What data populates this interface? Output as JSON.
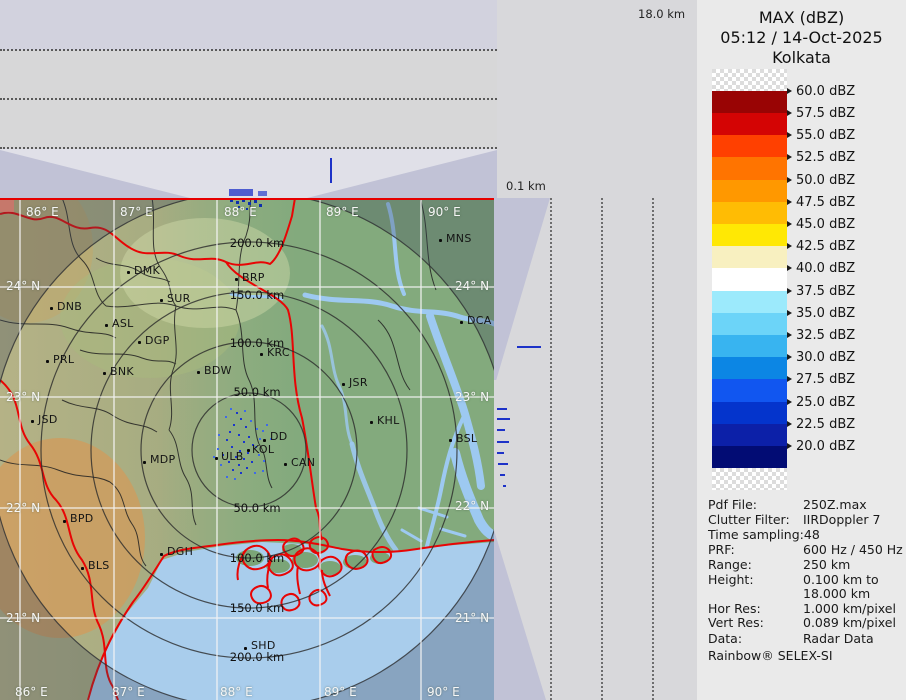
{
  "panels": {
    "top_height_label": "18.0 km",
    "side_height_label": "0.1 km"
  },
  "title": {
    "product": "MAX (dBZ)",
    "datetime": "05:12 / 14-Oct-2025",
    "site": "Kolkata"
  },
  "legend": {
    "labels": [
      "60.0 dBZ",
      "57.5 dBZ",
      "55.0 dBZ",
      "52.5 dBZ",
      "50.0 dBZ",
      "47.5 dBZ",
      "45.0 dBZ",
      "42.5 dBZ",
      "40.0 dBZ",
      "37.5 dBZ",
      "35.0 dBZ",
      "32.5 dBZ",
      "30.0 dBZ",
      "27.5 dBZ",
      "25.0 dBZ",
      "22.5 dBZ",
      "20.0 dBZ"
    ],
    "bands": [
      {
        "color": "#ffffff",
        "dither": true
      },
      {
        "color": "#990404"
      },
      {
        "color": "#d40404"
      },
      {
        "color": "#ff4000"
      },
      {
        "color": "#ff7400"
      },
      {
        "color": "#ff9800"
      },
      {
        "color": "#ffbc04"
      },
      {
        "color": "#ffe804"
      },
      {
        "color": "#f8f0c0"
      },
      {
        "color": "#ffffff"
      },
      {
        "color": "#9ceafc"
      },
      {
        "color": "#6cd4f8"
      },
      {
        "color": "#38b4f0"
      },
      {
        "color": "#0c86e4"
      },
      {
        "color": "#1156f0"
      },
      {
        "color": "#0434cc"
      },
      {
        "color": "#0c20a8"
      },
      {
        "color": "#020c74"
      },
      {
        "color": "#ffffff",
        "dither": true
      }
    ]
  },
  "metadata": {
    "rows": [
      {
        "label": "Pdf File:",
        "value": "250Z.max"
      },
      {
        "label": "Clutter Filter:",
        "value": "IIRDoppler 7"
      },
      {
        "label": "Time sampling:",
        "value": "48"
      },
      {
        "label": "PRF:",
        "value": "600 Hz / 450 Hz"
      },
      {
        "label": "Range:",
        "value": "250 km"
      },
      {
        "label": "Height:",
        "value": "0.100 km to"
      },
      {
        "label": "",
        "value": "18.000 km"
      },
      {
        "label": "Hor Res:",
        "value": "1.000 km/pixel"
      },
      {
        "label": "Vert Res:",
        "value": "0.089 km/pixel"
      },
      {
        "label": "Data:",
        "value": "Radar Data"
      }
    ],
    "footer": "Rainbow® SELEX-SI"
  },
  "map": {
    "lon_labels_top": [
      "86° E",
      "87° E",
      "88° E",
      "89° E",
      "90° E"
    ],
    "lon_labels_bottom": [
      "86° E",
      "87° E",
      "88° E",
      "89° E",
      "90° E"
    ],
    "lat_labels_left": [
      "24° N",
      "23° N",
      "22° N",
      "21° N"
    ],
    "lat_labels_right": [
      "24° N",
      "23° N",
      "22° N",
      "21° N"
    ],
    "ring_labels_top": [
      "200.0 km",
      "150.0 km",
      "100.0 km",
      "50.0 km"
    ],
    "ring_labels_bottom": [
      "50.0 km",
      "100.0 km",
      "150.0 km",
      "200.0 km"
    ],
    "stations": [
      {
        "code": "MNS"
      },
      {
        "code": "DMK"
      },
      {
        "code": "BRP"
      },
      {
        "code": "SUR"
      },
      {
        "code": "DNB"
      },
      {
        "code": "ASL"
      },
      {
        "code": "DGP"
      },
      {
        "code": "KRC"
      },
      {
        "code": "BDW"
      },
      {
        "code": "PRL"
      },
      {
        "code": "BNK"
      },
      {
        "code": "JSR"
      },
      {
        "code": "DCA"
      },
      {
        "code": "KHL"
      },
      {
        "code": "JSD"
      },
      {
        "code": "BSL"
      },
      {
        "code": "DD"
      },
      {
        "code": "KOL"
      },
      {
        "code": "ULB"
      },
      {
        "code": "CAN"
      },
      {
        "code": "MDP"
      },
      {
        "code": "BPD"
      },
      {
        "code": "DGH"
      },
      {
        "code": "BLS"
      },
      {
        "code": "SHD"
      }
    ]
  }
}
